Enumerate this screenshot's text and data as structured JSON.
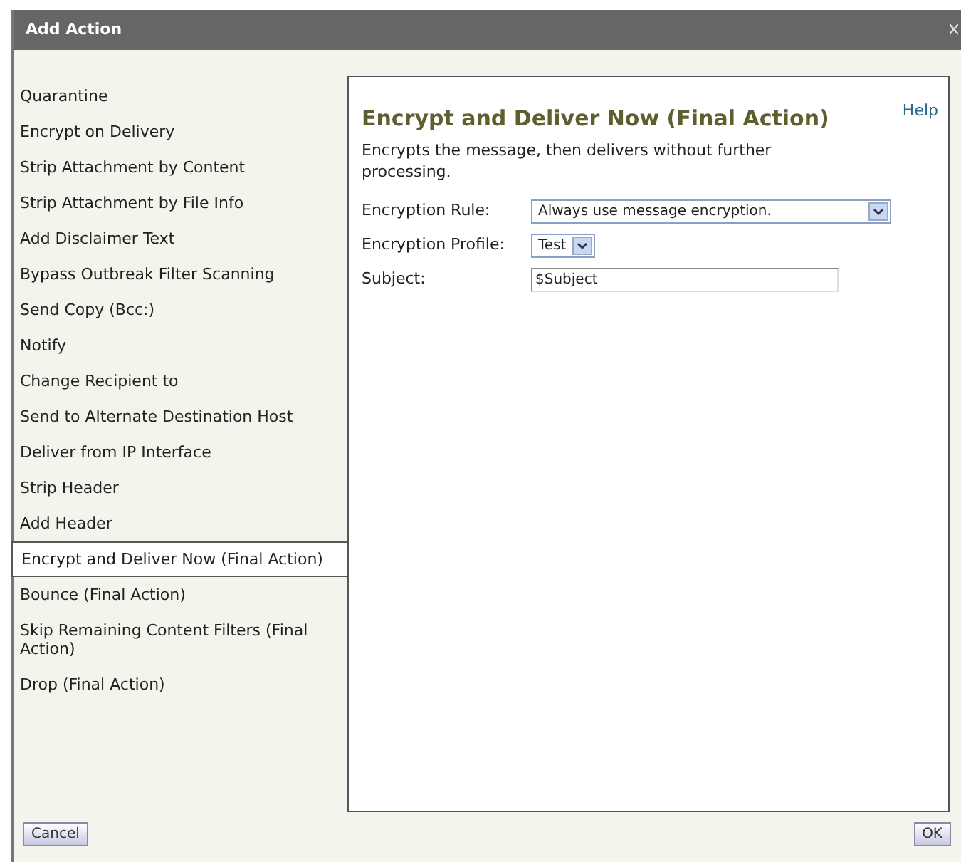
{
  "window": {
    "title": "Add Action"
  },
  "actions": [
    {
      "label": "Quarantine",
      "selected": false
    },
    {
      "label": "Encrypt on Delivery",
      "selected": false
    },
    {
      "label": "Strip Attachment by Content",
      "selected": false
    },
    {
      "label": "Strip Attachment by File Info",
      "selected": false
    },
    {
      "label": "Add Disclaimer Text",
      "selected": false
    },
    {
      "label": "Bypass Outbreak Filter Scanning",
      "selected": false
    },
    {
      "label": "Send Copy (Bcc:)",
      "selected": false
    },
    {
      "label": "Notify",
      "selected": false
    },
    {
      "label": "Change Recipient to",
      "selected": false
    },
    {
      "label": "Send to Alternate Destination Host",
      "selected": false
    },
    {
      "label": "Deliver from IP Interface",
      "selected": false
    },
    {
      "label": "Strip Header",
      "selected": false
    },
    {
      "label": "Add Header",
      "selected": false
    },
    {
      "label": "Encrypt and Deliver Now (Final Action)",
      "selected": true
    },
    {
      "label": "Bounce (Final Action)",
      "selected": false
    },
    {
      "label": "Skip Remaining Content Filters (Final Action)",
      "selected": false
    },
    {
      "label": "Drop (Final Action)",
      "selected": false
    }
  ],
  "detail": {
    "title": "Encrypt and Deliver Now (Final Action)",
    "help": "Help",
    "description": "Encrypts the message, then delivers without further processing.",
    "fields": [
      {
        "kind": "select",
        "label": "Encryption Rule:",
        "value": "Always use message encryption."
      },
      {
        "kind": "select",
        "label": "Encryption Profile:",
        "value": "Test"
      },
      {
        "kind": "text",
        "label": "Subject:",
        "value": "$Subject"
      }
    ]
  },
  "buttons": {
    "cancel": "Cancel",
    "ok": "OK"
  }
}
